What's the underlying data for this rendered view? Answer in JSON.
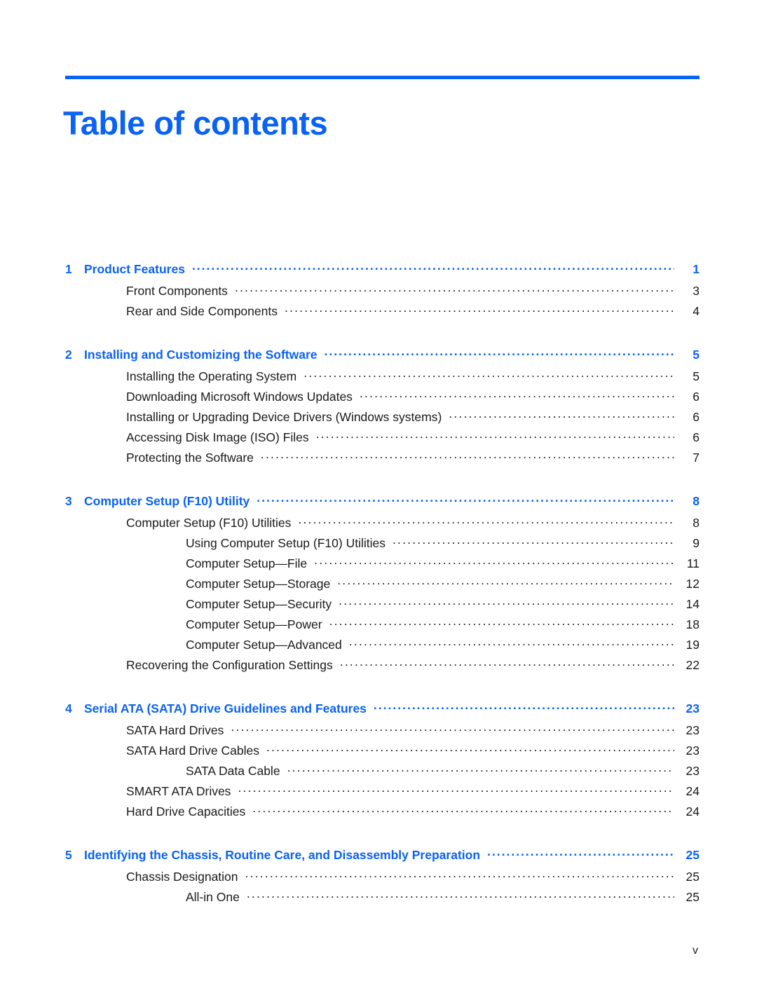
{
  "document": {
    "title": "Table of contents",
    "accent_color": "#0a62f5",
    "text_color": "#1a1a1a",
    "folio": "v"
  },
  "toc": {
    "entries": [
      {
        "level": "chapter",
        "number": "1",
        "label": "Product Features",
        "page": "1"
      },
      {
        "level": "lvl1",
        "number": "",
        "label": "Front Components",
        "page": "3"
      },
      {
        "level": "lvl1",
        "number": "",
        "label": "Rear and Side Components",
        "page": "4"
      },
      {
        "level": "chapter",
        "number": "2",
        "label": "Installing and Customizing the Software",
        "page": "5"
      },
      {
        "level": "lvl1",
        "number": "",
        "label": "Installing the Operating System",
        "page": "5"
      },
      {
        "level": "lvl1",
        "number": "",
        "label": "Downloading Microsoft Windows Updates",
        "page": "6"
      },
      {
        "level": "lvl1",
        "number": "",
        "label": "Installing or Upgrading Device Drivers (Windows systems)",
        "page": "6"
      },
      {
        "level": "lvl1",
        "number": "",
        "label": "Accessing Disk Image (ISO) Files",
        "page": "6"
      },
      {
        "level": "lvl1",
        "number": "",
        "label": "Protecting the Software",
        "page": "7"
      },
      {
        "level": "chapter",
        "number": "3",
        "label": "Computer Setup (F10) Utility",
        "page": "8"
      },
      {
        "level": "lvl1",
        "number": "",
        "label": "Computer Setup (F10) Utilities",
        "page": "8"
      },
      {
        "level": "lvl2",
        "number": "",
        "label": "Using Computer Setup (F10) Utilities",
        "page": "9"
      },
      {
        "level": "lvl2",
        "number": "",
        "label": "Computer Setup—File",
        "page": "11"
      },
      {
        "level": "lvl2",
        "number": "",
        "label": "Computer Setup—Storage",
        "page": "12"
      },
      {
        "level": "lvl2",
        "number": "",
        "label": "Computer Setup—Security",
        "page": "14"
      },
      {
        "level": "lvl2",
        "number": "",
        "label": "Computer Setup—Power",
        "page": "18"
      },
      {
        "level": "lvl2",
        "number": "",
        "label": "Computer Setup—Advanced",
        "page": "19"
      },
      {
        "level": "lvl1",
        "number": "",
        "label": "Recovering the Configuration Settings",
        "page": "22"
      },
      {
        "level": "chapter",
        "number": "4",
        "label": "Serial ATA (SATA) Drive Guidelines and Features",
        "page": "23"
      },
      {
        "level": "lvl1",
        "number": "",
        "label": "SATA Hard Drives",
        "page": "23"
      },
      {
        "level": "lvl1",
        "number": "",
        "label": "SATA Hard Drive Cables",
        "page": "23"
      },
      {
        "level": "lvl2",
        "number": "",
        "label": "SATA Data Cable",
        "page": "23"
      },
      {
        "level": "lvl1",
        "number": "",
        "label": "SMART ATA Drives",
        "page": "24"
      },
      {
        "level": "lvl1",
        "number": "",
        "label": "Hard Drive Capacities",
        "page": "24"
      },
      {
        "level": "chapter",
        "number": "5",
        "label": "Identifying the Chassis, Routine Care, and Disassembly Preparation",
        "page": "25"
      },
      {
        "level": "lvl1",
        "number": "",
        "label": "Chassis Designation",
        "page": "25"
      },
      {
        "level": "lvl2",
        "number": "",
        "label": "All-in One",
        "page": "25"
      }
    ]
  }
}
